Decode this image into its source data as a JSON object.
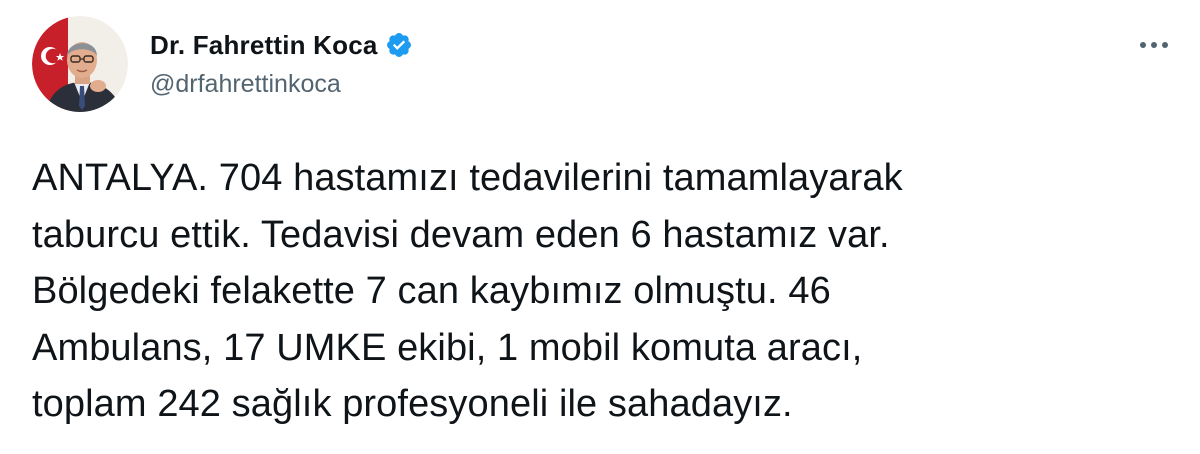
{
  "author": {
    "display_name": "Dr. Fahrettin Koca",
    "handle": "@drfahrettinkoca",
    "verified": true,
    "verified_icon": "verified-badge-icon",
    "avatar_icon": "profile-photo"
  },
  "menu": {
    "icon": "more-horizontal-icon"
  },
  "tweet": {
    "text": "ANTALYA. 704 hastamızı tedavilerini tamamlayarak\ntaburcu ettik. Tedavisi devam eden 6 hastamız var.\nBölgedeki felakette 7 can kaybımız olmuştu. 46\nAmbulans, 17 UMKE ekibi, 1 mobil komuta aracı,\ntoplam 242 sağlık profesyoneli ile sahadayız."
  },
  "colors": {
    "text_primary": "#0f1419",
    "text_secondary": "#536471",
    "verified_blue": "#1d9bf0",
    "background": "#ffffff"
  }
}
